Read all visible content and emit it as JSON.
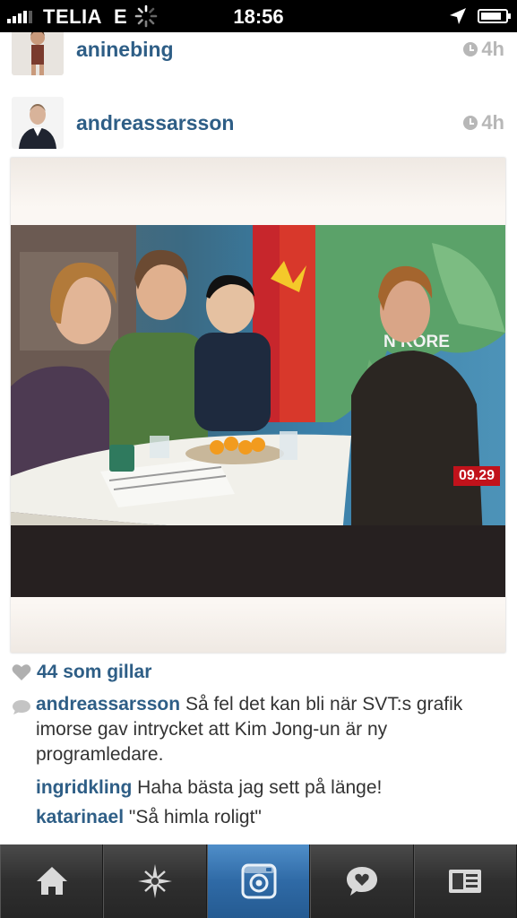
{
  "status_bar": {
    "carrier": "TELIA",
    "network": "E",
    "time": "18:56"
  },
  "posts": [
    {
      "username": "aninebing",
      "time_ago": "4h"
    },
    {
      "username": "andreassarsson",
      "time_ago": "4h",
      "photo_overlay_time": "09.29",
      "photo_map_text": "N KORE",
      "likes": "44 som gillar",
      "comments": [
        {
          "user": "andreassarsson",
          "text": "Så fel det kan bli när SVT:s grafik imorse gav intrycket att Kim Jong-un är ny programledare."
        },
        {
          "user": "ingridkling",
          "text": "Haha bästa jag sett på länge!"
        },
        {
          "user": "katarinael",
          "text": "\"Så himla roligt\""
        }
      ]
    }
  ],
  "tabbar": {
    "tabs": [
      {
        "icon": "home-icon"
      },
      {
        "icon": "explore-star-icon"
      },
      {
        "icon": "camera-icon",
        "active": true
      },
      {
        "icon": "news-bubble-icon"
      },
      {
        "icon": "profile-card-icon"
      }
    ]
  },
  "colors": {
    "username": "#2e5e86",
    "tab_active": "#2f6aa6",
    "tab_bar": "#2b2b2b"
  }
}
